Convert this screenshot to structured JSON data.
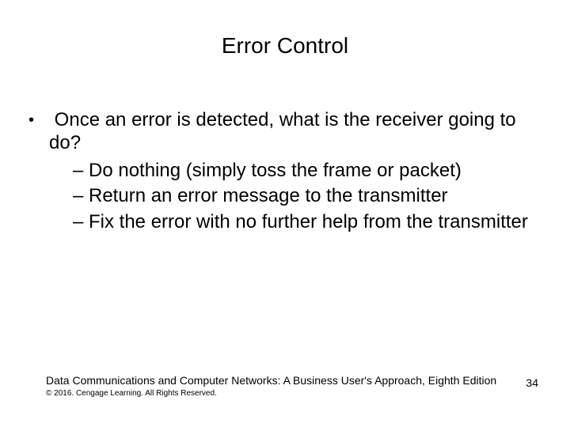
{
  "title": "Error Control",
  "bullets": {
    "main": "Once an error is detected, what is the receiver going to do?",
    "subs": [
      "Do nothing (simply toss the frame or packet)",
      "Return an error message to the transmitter",
      "Fix the error with no further help from the transmitter"
    ]
  },
  "footer": {
    "book": "Data Communications and Computer Networks: A Business User's Approach, Eighth Edition",
    "copyright": "© 2016. Cengage Learning. All Rights Reserved."
  },
  "page_number": "34"
}
